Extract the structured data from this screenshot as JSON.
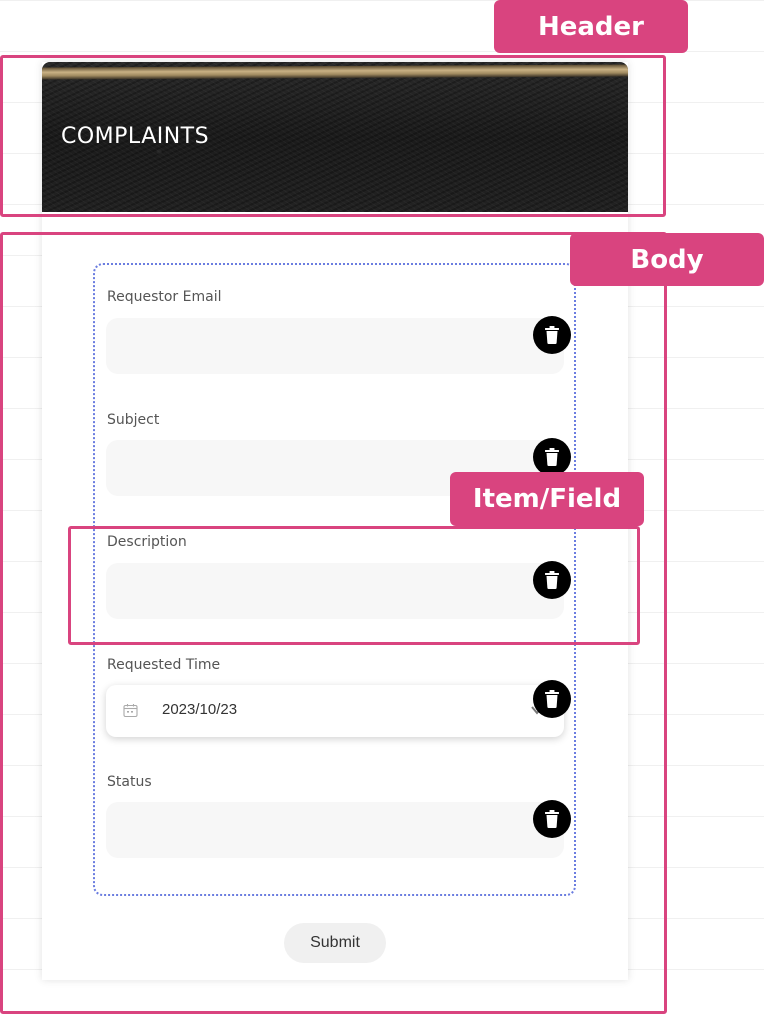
{
  "header": {
    "title": "COMPLAINTS"
  },
  "form": {
    "fields": [
      {
        "label": "Requestor Email",
        "value": ""
      },
      {
        "label": "Subject",
        "value": ""
      },
      {
        "label": "Description",
        "value": ""
      },
      {
        "label": "Requested Time",
        "value": "2023/10/23"
      },
      {
        "label": "Status",
        "value": ""
      }
    ],
    "submit_label": "Submit"
  },
  "annotations": {
    "header_tag": "Header",
    "body_tag": "Body",
    "field_tag": "Item/Field"
  },
  "icons": {
    "delete": "trash-icon",
    "calendar": "calendar-icon",
    "dropdown": "chevron-down-icon"
  },
  "colors": {
    "annotation": "#d9447f",
    "form_border": "#6b7de0",
    "field_bg": "#f7f7f7",
    "delete_button": "#000000"
  }
}
